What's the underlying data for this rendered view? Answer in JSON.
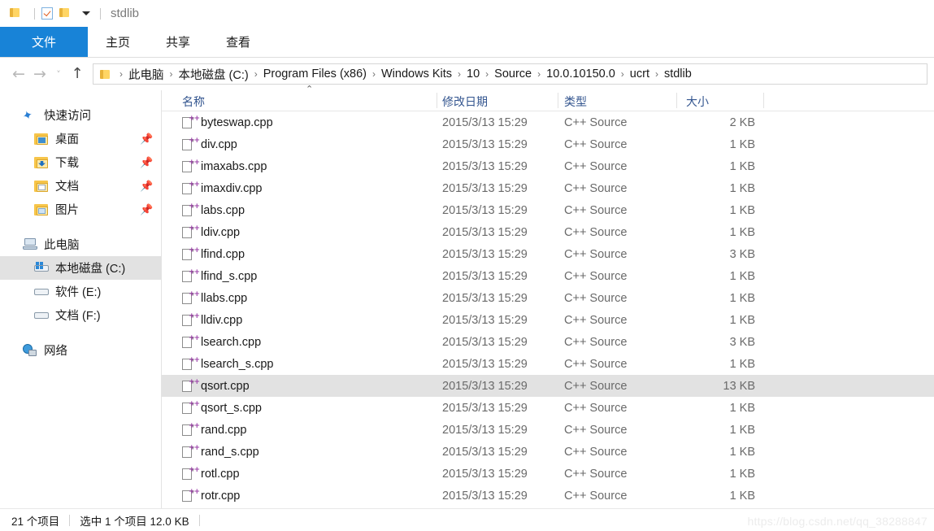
{
  "titlebar": {
    "title": "stdlib",
    "quick_access": [
      {
        "name": "folder-icon",
        "label": ""
      },
      {
        "name": "properties-icon",
        "label": ""
      },
      {
        "name": "new-folder-icon",
        "label": ""
      }
    ]
  },
  "ribbon": {
    "tabs": [
      {
        "label": "文件",
        "active": true
      },
      {
        "label": "主页",
        "active": false
      },
      {
        "label": "共享",
        "active": false
      },
      {
        "label": "查看",
        "active": false
      }
    ]
  },
  "address": {
    "back_icon": "←",
    "forward_icon": "→",
    "recent_icon": "˅",
    "up_icon": "↑",
    "crumbs": [
      "此电脑",
      "本地磁盘 (C:)",
      "Program Files (x86)",
      "Windows Kits",
      "10",
      "Source",
      "10.0.10150.0",
      "ucrt",
      "stdlib"
    ],
    "separator": "›"
  },
  "sidebar": {
    "groups": [
      {
        "header": {
          "label": "快速访问",
          "icon": "star-icon"
        },
        "items": [
          {
            "label": "桌面",
            "icon": "folder-desktop-icon",
            "pinned": true
          },
          {
            "label": "下载",
            "icon": "folder-downloads-icon",
            "pinned": true
          },
          {
            "label": "文档",
            "icon": "folder-documents-icon",
            "pinned": true
          },
          {
            "label": "图片",
            "icon": "folder-pictures-icon",
            "pinned": true
          }
        ]
      },
      {
        "header": {
          "label": "此电脑",
          "icon": "this-pc-icon"
        },
        "items": [
          {
            "label": "本地磁盘 (C:)",
            "icon": "local-disk-icon",
            "selected": true
          },
          {
            "label": "软件 (E:)",
            "icon": "drive-icon",
            "selected": false
          },
          {
            "label": "文档 (F:)",
            "icon": "drive-icon",
            "selected": false
          }
        ]
      },
      {
        "header": {
          "label": "网络",
          "icon": "network-icon"
        },
        "items": []
      }
    ],
    "pin_glyph": "📌"
  },
  "filelist": {
    "columns": [
      {
        "key": "name",
        "label": "名称",
        "sorted": "asc"
      },
      {
        "key": "date",
        "label": "修改日期"
      },
      {
        "key": "type",
        "label": "类型"
      },
      {
        "key": "size",
        "label": "大小"
      }
    ],
    "sort_caret": "⌃",
    "rows": [
      {
        "name": "byteswap.cpp",
        "date": "2015/3/13 15:29",
        "type": "C++ Source",
        "size": "2 KB",
        "selected": false
      },
      {
        "name": "div.cpp",
        "date": "2015/3/13 15:29",
        "type": "C++ Source",
        "size": "1 KB",
        "selected": false
      },
      {
        "name": "imaxabs.cpp",
        "date": "2015/3/13 15:29",
        "type": "C++ Source",
        "size": "1 KB",
        "selected": false
      },
      {
        "name": "imaxdiv.cpp",
        "date": "2015/3/13 15:29",
        "type": "C++ Source",
        "size": "1 KB",
        "selected": false
      },
      {
        "name": "labs.cpp",
        "date": "2015/3/13 15:29",
        "type": "C++ Source",
        "size": "1 KB",
        "selected": false
      },
      {
        "name": "ldiv.cpp",
        "date": "2015/3/13 15:29",
        "type": "C++ Source",
        "size": "1 KB",
        "selected": false
      },
      {
        "name": "lfind.cpp",
        "date": "2015/3/13 15:29",
        "type": "C++ Source",
        "size": "3 KB",
        "selected": false
      },
      {
        "name": "lfind_s.cpp",
        "date": "2015/3/13 15:29",
        "type": "C++ Source",
        "size": "1 KB",
        "selected": false
      },
      {
        "name": "llabs.cpp",
        "date": "2015/3/13 15:29",
        "type": "C++ Source",
        "size": "1 KB",
        "selected": false
      },
      {
        "name": "lldiv.cpp",
        "date": "2015/3/13 15:29",
        "type": "C++ Source",
        "size": "1 KB",
        "selected": false
      },
      {
        "name": "lsearch.cpp",
        "date": "2015/3/13 15:29",
        "type": "C++ Source",
        "size": "3 KB",
        "selected": false
      },
      {
        "name": "lsearch_s.cpp",
        "date": "2015/3/13 15:29",
        "type": "C++ Source",
        "size": "1 KB",
        "selected": false
      },
      {
        "name": "qsort.cpp",
        "date": "2015/3/13 15:29",
        "type": "C++ Source",
        "size": "13 KB",
        "selected": true
      },
      {
        "name": "qsort_s.cpp",
        "date": "2015/3/13 15:29",
        "type": "C++ Source",
        "size": "1 KB",
        "selected": false
      },
      {
        "name": "rand.cpp",
        "date": "2015/3/13 15:29",
        "type": "C++ Source",
        "size": "1 KB",
        "selected": false
      },
      {
        "name": "rand_s.cpp",
        "date": "2015/3/13 15:29",
        "type": "C++ Source",
        "size": "1 KB",
        "selected": false
      },
      {
        "name": "rotl.cpp",
        "date": "2015/3/13 15:29",
        "type": "C++ Source",
        "size": "1 KB",
        "selected": false
      },
      {
        "name": "rotr.cpp",
        "date": "2015/3/13 15:29",
        "type": "C++ Source",
        "size": "1 KB",
        "selected": false
      }
    ]
  },
  "statusbar": {
    "item_count": "21 个项目",
    "selection": "选中 1 个项目  12.0 KB"
  },
  "watermark": "https://blog.csdn.net/qq_38288847",
  "colors": {
    "accent": "#1883d7",
    "selection": "#e2e2e2",
    "header_text": "#33558f",
    "secondary_text": "#6a6a6a",
    "cpp_marker": "#9b3fa8"
  }
}
